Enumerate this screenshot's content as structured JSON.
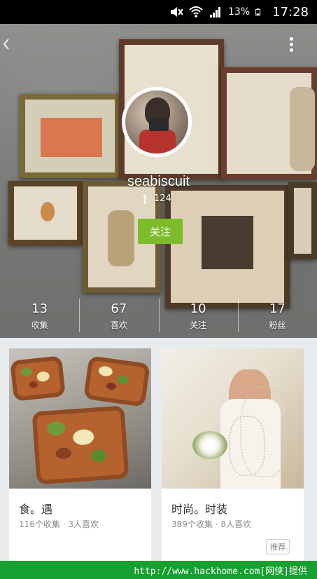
{
  "status_bar": {
    "battery_percent": "13%",
    "time": "17:28",
    "icons": [
      "mute-icon",
      "wifi-icon",
      "signal-icon",
      "battery-icon"
    ]
  },
  "header": {
    "back_icon": "chevron-left-icon",
    "more_icon": "more-vertical-icon",
    "username": "seabiscuit",
    "liked_count": "124",
    "follow_label": "关注",
    "accent_color": "#7cbb2a"
  },
  "stats": [
    {
      "value": "13",
      "label": "收集"
    },
    {
      "value": "67",
      "label": "喜欢"
    },
    {
      "value": "10",
      "label": "关注"
    },
    {
      "value": "17",
      "label": "粉丝"
    }
  ],
  "boards": [
    {
      "title": "食。遇",
      "meta": "116个收集 · 3人喜欢"
    },
    {
      "title": "时尚。时装",
      "meta": "389个收集 · 8人喜欢",
      "tag": "推荐"
    }
  ],
  "watermark": "http://www.hackhome.com[网侠]提供"
}
